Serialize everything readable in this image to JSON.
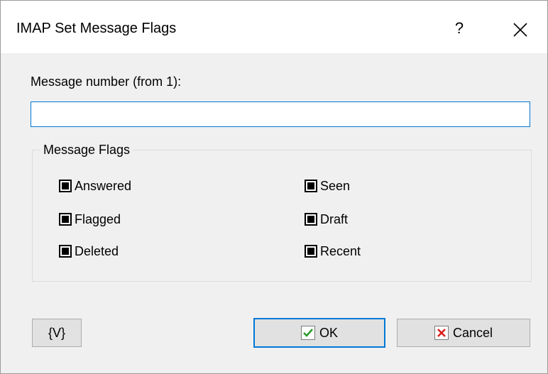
{
  "window": {
    "title": "IMAP Set Message Flags",
    "help_glyph": "?",
    "close_icon": "close-icon"
  },
  "form": {
    "message_number_label": "Message number (from 1):",
    "message_number_value": "",
    "message_number_placeholder": ""
  },
  "flags_group": {
    "legend": "Message Flags",
    "left": [
      {
        "label": "Answered",
        "checked": true
      },
      {
        "label": "Flagged",
        "checked": true
      },
      {
        "label": "Deleted",
        "checked": true
      }
    ],
    "right": [
      {
        "label": "Seen",
        "checked": true
      },
      {
        "label": "Draft",
        "checked": true
      },
      {
        "label": "Recent",
        "checked": true
      }
    ]
  },
  "buttons": {
    "variables_label": "{V}",
    "ok_label": "OK",
    "ok_icon": "checkmark-icon",
    "cancel_label": "Cancel",
    "cancel_icon": "x-icon"
  },
  "colors": {
    "accent": "#0078d7",
    "ok_check": "#2a9d2a",
    "cancel_x": "#d9201c"
  }
}
